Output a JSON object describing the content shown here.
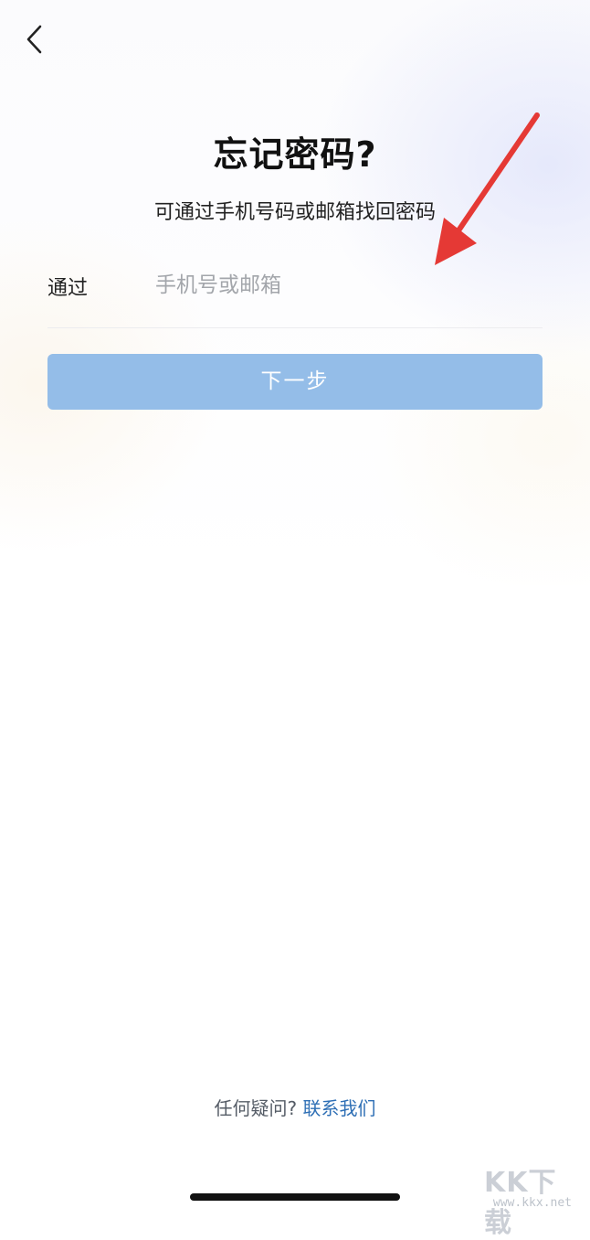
{
  "header": {
    "back_icon": "chevron-left-icon"
  },
  "page": {
    "title": "忘记密码?",
    "subtitle": "可通过手机号码或邮箱找回密码"
  },
  "form": {
    "label": "通过",
    "placeholder": "手机号或邮箱",
    "value": "",
    "next_label": "下一步"
  },
  "footer": {
    "question": "任何疑问?",
    "contact_label": "联系我们"
  },
  "annotation": {
    "arrow_icon": "red-arrow-icon",
    "arrow_color": "#e53935"
  },
  "watermark": {
    "logo": "KK下载",
    "url": "www.kkx.net"
  },
  "colors": {
    "button_bg": "#94bde8",
    "link": "#2e6fb5"
  }
}
